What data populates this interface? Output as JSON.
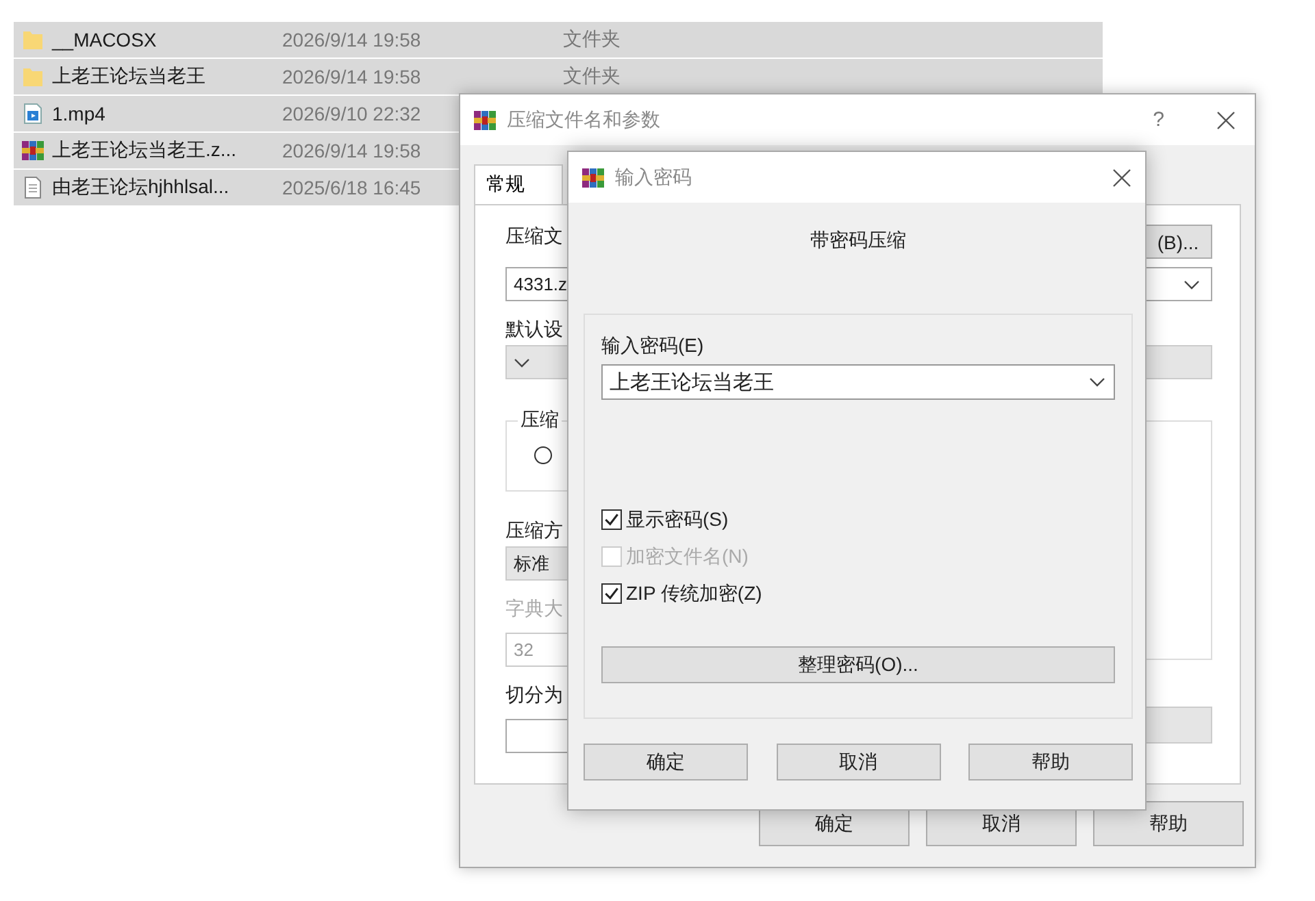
{
  "files": [
    {
      "kind": "folder",
      "name": "__MACOSX",
      "modified": "2026/9/14 19:58",
      "type": "文件夹",
      "selected": true
    },
    {
      "kind": "folder",
      "name": "上老王论坛当老王",
      "modified": "2026/9/14 19:58",
      "type": "文件夹",
      "selected": true
    },
    {
      "kind": "video",
      "name": "1.mp4",
      "modified": "2026/9/10 22:32",
      "selected": true
    },
    {
      "kind": "archive",
      "name": "上老王论坛当老王.z...",
      "modified": "2026/9/14 19:58",
      "selected": true
    },
    {
      "kind": "text",
      "name": "由老王论坛hjhhlsal...",
      "modified": "2025/6/18 16:45",
      "selected": true
    }
  ],
  "compress_dialog": {
    "title": "压缩文件名和参数",
    "help": "?",
    "tabs": [
      {
        "label": "常规",
        "selected": true
      }
    ],
    "archive_name_label": "压缩文",
    "browse_button": "(B)...",
    "archive_name_value": "4331.z",
    "profile_label": "默认设",
    "format_group_label": "压缩",
    "format_radio_selected": false,
    "method_label": "压缩方",
    "method_value": "标准",
    "dict_label": "字典大",
    "dict_value": "32",
    "dict_disabled": true,
    "split_label": "切分为",
    "buttons": [
      "确定",
      "取消",
      "帮助"
    ]
  },
  "password_dialog": {
    "title": "输入密码",
    "heading": "带密码压缩",
    "password_label": "输入密码(E)",
    "password_value": "上老王论坛当老王",
    "options": [
      {
        "label": "显示密码(S)",
        "checked": true,
        "disabled": false
      },
      {
        "label": "加密文件名(N)",
        "checked": false,
        "disabled": true
      },
      {
        "label": "ZIP 传统加密(Z)",
        "checked": true,
        "disabled": false
      }
    ],
    "organize_button": "整理密码(O)...",
    "buttons": [
      "确定",
      "取消",
      "帮助"
    ]
  }
}
